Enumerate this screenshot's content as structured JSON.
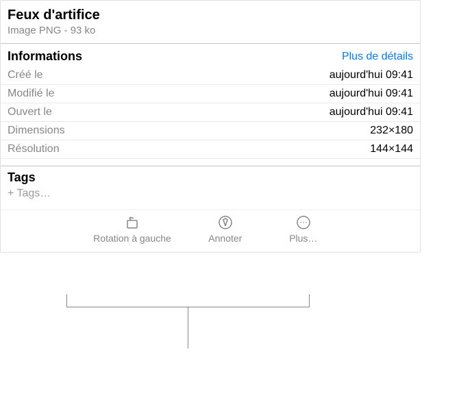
{
  "file": {
    "title": "Feux d'artifice",
    "subtitle": "Image PNG - 93 ko"
  },
  "info": {
    "heading": "Informations",
    "more": "Plus de détails",
    "rows": [
      {
        "label": "Créé le",
        "value": "aujourd'hui 09:41"
      },
      {
        "label": "Modifié le",
        "value": "aujourd'hui 09:41"
      },
      {
        "label": "Ouvert le",
        "value": "aujourd'hui 09:41"
      },
      {
        "label": "Dimensions",
        "value": "232×180"
      },
      {
        "label": "Résolution",
        "value": "144×144"
      }
    ]
  },
  "tags": {
    "heading": "Tags",
    "add": "+ Tags…"
  },
  "toolbar": {
    "rotate": "Rotation à gauche",
    "annotate": "Annoter",
    "more": "Plus…"
  }
}
